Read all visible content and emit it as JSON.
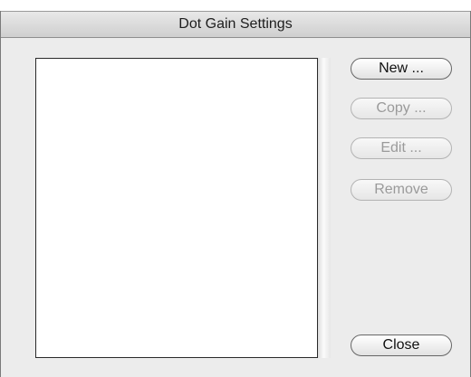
{
  "window": {
    "title": "Dot Gain Settings"
  },
  "list": {
    "items": []
  },
  "buttons": {
    "new_label": "New ...",
    "copy_label": "Copy ...",
    "edit_label": "Edit ...",
    "remove_label": "Remove",
    "close_label": "Close"
  },
  "states": {
    "new_enabled": true,
    "copy_enabled": false,
    "edit_enabled": false,
    "remove_enabled": false,
    "close_enabled": true
  }
}
